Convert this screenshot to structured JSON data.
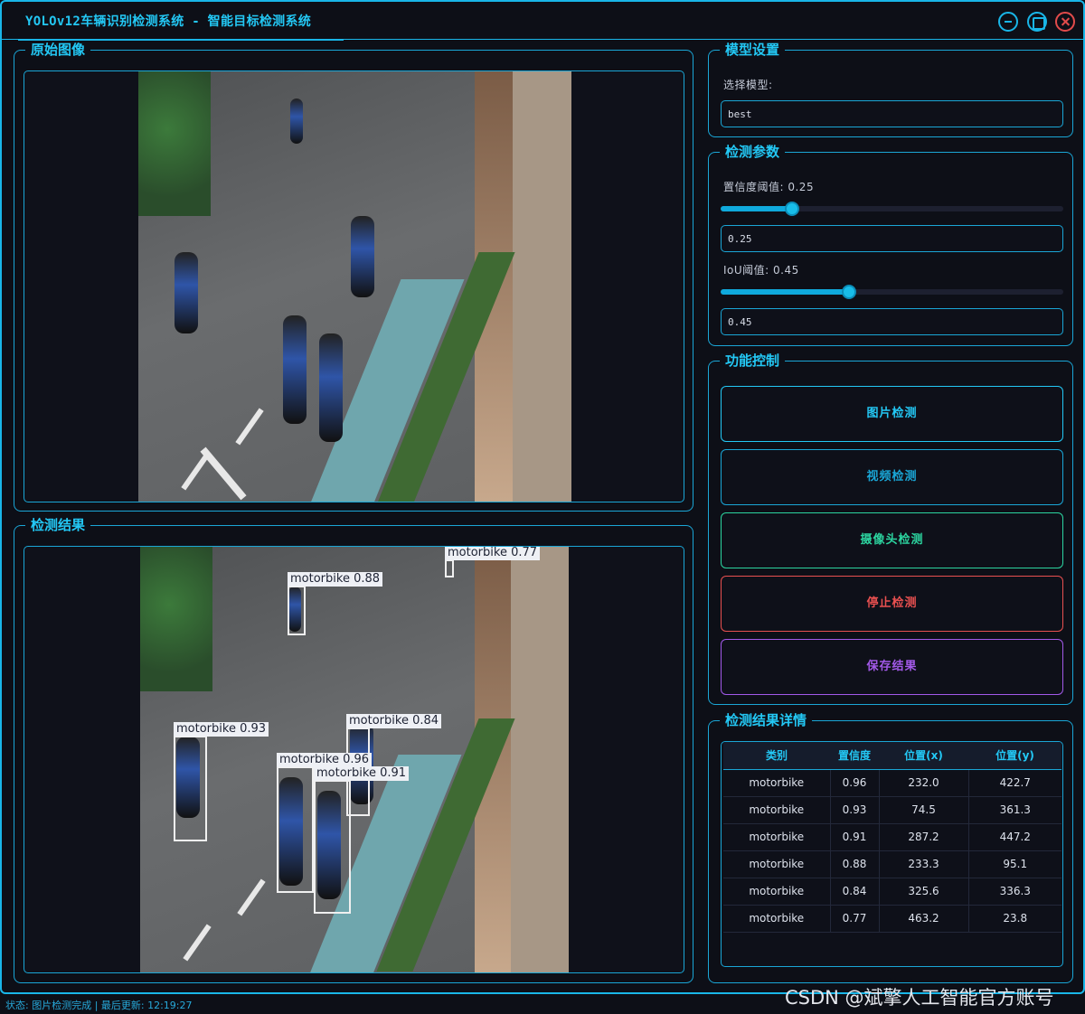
{
  "window": {
    "title": "YOLOv12车辆识别检测系统 - 智能目标检测系统"
  },
  "panels": {
    "original": {
      "title": "原始图像"
    },
    "result": {
      "title": "检测结果"
    }
  },
  "detections_overlay": [
    {
      "label": "motorbike 0.77"
    },
    {
      "label": "motorbike 0.88"
    },
    {
      "label": "motorbike 0.93"
    },
    {
      "label": "motorbike 0.84"
    },
    {
      "label": "motorbike 0.96"
    },
    {
      "label": "motorbike 0.91"
    }
  ],
  "model_settings": {
    "title": "模型设置",
    "select_label": "选择模型:",
    "selected_model": "best"
  },
  "detection_params": {
    "title": "检测参数",
    "confidence_label": "置信度阈值: 0.25",
    "confidence_value": "0.25",
    "confidence_fraction": 0.25,
    "iou_label": "IoU阈值: 0.45",
    "iou_value": "0.45",
    "iou_fraction": 0.45
  },
  "function_control": {
    "title": "功能控制",
    "image_detect": "图片检测",
    "video_detect": "视频检测",
    "camera_detect": "摄像头检测",
    "stop_detect": "停止检测",
    "save_result": "保存结果",
    "colors": {
      "image": "#23c8f5",
      "video": "#1aa6d6",
      "camera": "#2cd5a0",
      "stop": "#e85050",
      "save": "#a259e8"
    }
  },
  "result_details": {
    "title": "检测结果详情",
    "columns": [
      "类别",
      "置信度",
      "位置(x)",
      "位置(y)"
    ],
    "rows": [
      [
        "motorbike",
        "0.96",
        "232.0",
        "422.7"
      ],
      [
        "motorbike",
        "0.93",
        "74.5",
        "361.3"
      ],
      [
        "motorbike",
        "0.91",
        "287.2",
        "447.2"
      ],
      [
        "motorbike",
        "0.88",
        "233.3",
        "95.1"
      ],
      [
        "motorbike",
        "0.84",
        "325.6",
        "336.3"
      ],
      [
        "motorbike",
        "0.77",
        "463.2",
        "23.8"
      ]
    ]
  },
  "status": {
    "text": "状态: 图片检测完成 | 最后更新: 12:19:27"
  },
  "watermark": {
    "text": "CSDN @斌擎人工智能官方账号"
  },
  "theme": {
    "accent": "#23c8f5",
    "background": "#0d0f17"
  }
}
